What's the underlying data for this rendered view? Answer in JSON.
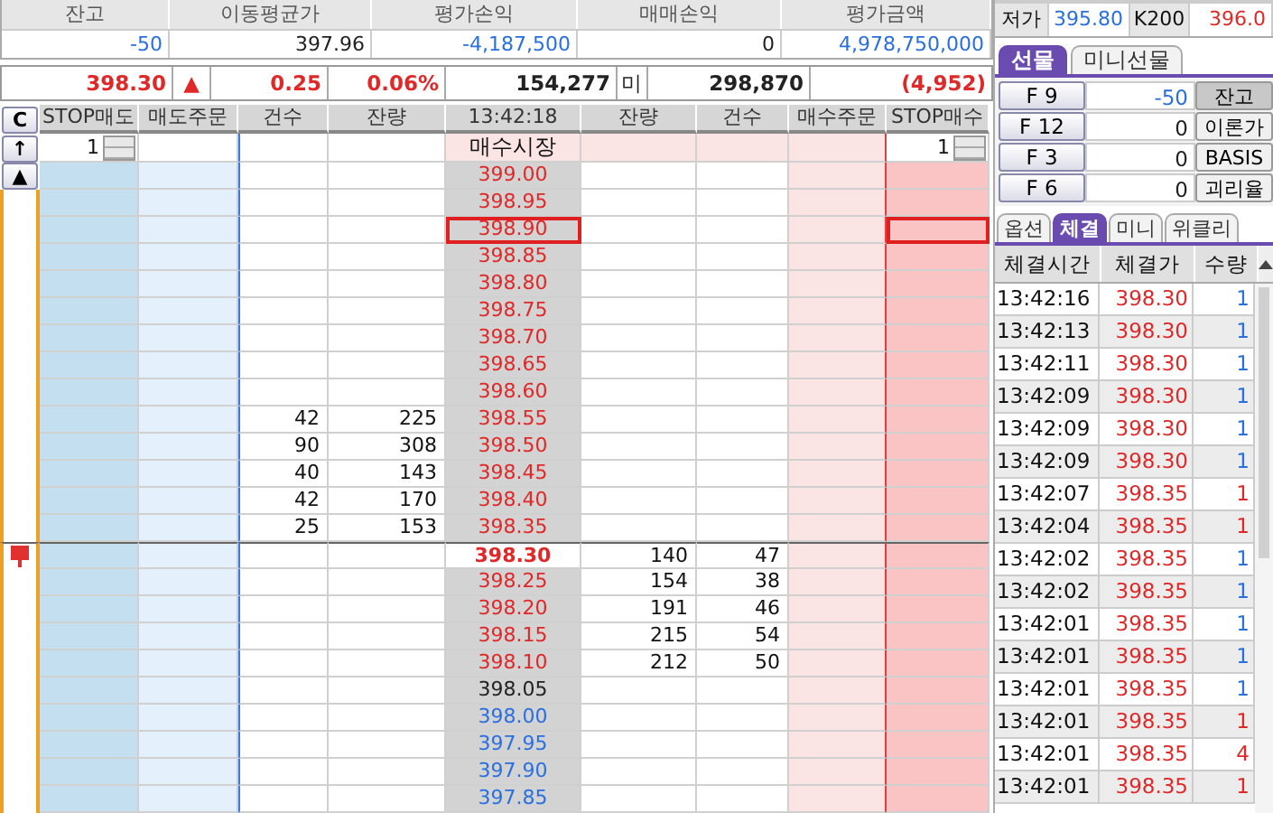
{
  "summary": {
    "columns": [
      "잔고",
      "이동평균가",
      "평가손익",
      "매매손익",
      "평가금액"
    ],
    "values": [
      {
        "text": "-50",
        "color": "#2a6fe0"
      },
      {
        "text": "397.96",
        "color": "#222222"
      },
      {
        "text": "-4,187,500",
        "color": "#2a6fe0"
      },
      {
        "text": "0",
        "color": "#222222"
      },
      {
        "text": "4,978,750,000",
        "color": "#2a6fe0"
      }
    ]
  },
  "quote": [
    {
      "text": "398.30",
      "color": "#e02828"
    },
    {
      "text": "▲",
      "color": "#e02828"
    },
    {
      "text": "0.25",
      "color": "#e02828"
    },
    {
      "text": "0.06%",
      "color": "#e02828"
    },
    {
      "text": "154,277",
      "color": "#222222"
    },
    {
      "text": "미",
      "color": "#222222"
    },
    {
      "text": "298,870",
      "color": "#222222"
    },
    {
      "text": "(4,952)",
      "color": "#e02828"
    }
  ],
  "side_buttons": [
    "C",
    "↑",
    "▲"
  ],
  "order_grid": {
    "columns": [
      "STOP매도",
      "매도주문",
      "건수",
      "잔량",
      "13:42:18",
      "잔량",
      "건수",
      "매수주문",
      "STOP매수"
    ],
    "stop_sell_qty": "1",
    "market_buy": "매수시장",
    "stop_buy_qty": "1",
    "rows": [
      {
        "price": "399.00",
        "color": "#e02828",
        "current": false,
        "outlined": false
      },
      {
        "price": "398.95",
        "color": "#e02828",
        "current": false,
        "outlined": false
      },
      {
        "price": "398.90",
        "color": "#e02828",
        "current": false,
        "outlined": true
      },
      {
        "price": "398.85",
        "color": "#e02828",
        "current": false,
        "outlined": false
      },
      {
        "price": "398.80",
        "color": "#e02828",
        "current": false,
        "outlined": false
      },
      {
        "price": "398.75",
        "color": "#e02828",
        "current": false,
        "outlined": false
      },
      {
        "price": "398.70",
        "color": "#e02828",
        "current": false,
        "outlined": false
      },
      {
        "price": "398.65",
        "color": "#e02828",
        "current": false,
        "outlined": false
      },
      {
        "price": "398.60",
        "color": "#e02828",
        "current": false,
        "outlined": false
      },
      {
        "price": "398.55",
        "color": "#e02828",
        "current": false,
        "outlined": false,
        "sell_count": "42",
        "sell_qty": "225"
      },
      {
        "price": "398.50",
        "color": "#e02828",
        "current": false,
        "outlined": false,
        "sell_count": "90",
        "sell_qty": "308"
      },
      {
        "price": "398.45",
        "color": "#e02828",
        "current": false,
        "outlined": false,
        "sell_count": "40",
        "sell_qty": "143"
      },
      {
        "price": "398.40",
        "color": "#e02828",
        "current": false,
        "outlined": false,
        "sell_count": "42",
        "sell_qty": "170"
      },
      {
        "price": "398.35",
        "color": "#e02828",
        "current": false,
        "outlined": false,
        "sell_count": "25",
        "sell_qty": "153"
      },
      {
        "price": "398.30",
        "color": "#e02828",
        "current": true,
        "outlined": false,
        "buy_qty": "140",
        "buy_count": "47"
      },
      {
        "price": "398.25",
        "color": "#e02828",
        "current": false,
        "outlined": false,
        "buy_qty": "154",
        "buy_count": "38"
      },
      {
        "price": "398.20",
        "color": "#e02828",
        "current": false,
        "outlined": false,
        "buy_qty": "191",
        "buy_count": "46"
      },
      {
        "price": "398.15",
        "color": "#e02828",
        "current": false,
        "outlined": false,
        "buy_qty": "215",
        "buy_count": "54"
      },
      {
        "price": "398.10",
        "color": "#e02828",
        "current": false,
        "outlined": false,
        "buy_qty": "212",
        "buy_count": "50"
      },
      {
        "price": "398.05",
        "color": "#222222",
        "current": false,
        "outlined": false
      },
      {
        "price": "398.00",
        "color": "#2a6fe0",
        "current": false,
        "outlined": false
      },
      {
        "price": "397.95",
        "color": "#2a6fe0",
        "current": false,
        "outlined": false
      },
      {
        "price": "397.90",
        "color": "#2a6fe0",
        "current": false,
        "outlined": false
      },
      {
        "price": "397.85",
        "color": "#2a6fe0",
        "current": false,
        "outlined": false
      }
    ]
  },
  "price_info": [
    {
      "label": "저가",
      "value": "395.80",
      "color": "#2a6fe0"
    },
    {
      "label": "K200",
      "value": "396.0",
      "color": "#e02828"
    }
  ],
  "futures_tabs": [
    {
      "label": "선물",
      "selected": true
    },
    {
      "label": "미니선물",
      "selected": false
    }
  ],
  "positions": [
    {
      "code": "F 9",
      "value": "-50",
      "color": "#2a6fe0",
      "action": "잔고",
      "pressed": true
    },
    {
      "code": "F 12",
      "value": "0",
      "color": "#222222",
      "action": "이론가",
      "pressed": false
    },
    {
      "code": "F 3",
      "value": "0",
      "color": "#222222",
      "action": "BASIS",
      "pressed": false
    },
    {
      "code": "F 6",
      "value": "0",
      "color": "#222222",
      "action": "괴리율",
      "pressed": false
    }
  ],
  "trade_tabs": [
    {
      "label": "옵션",
      "selected": false
    },
    {
      "label": "체결",
      "selected": true
    },
    {
      "label": "미니",
      "selected": false
    },
    {
      "label": "위클리",
      "selected": false
    }
  ],
  "trades": {
    "columns": [
      "체결시간",
      "체결가",
      "수량"
    ],
    "rows": [
      {
        "time": "13:42:16",
        "price": "398.30",
        "qty": "1",
        "color": "#2a6fe0"
      },
      {
        "time": "13:42:13",
        "price": "398.30",
        "qty": "1",
        "color": "#2a6fe0"
      },
      {
        "time": "13:42:11",
        "price": "398.30",
        "qty": "1",
        "color": "#2a6fe0"
      },
      {
        "time": "13:42:09",
        "price": "398.30",
        "qty": "1",
        "color": "#2a6fe0"
      },
      {
        "time": "13:42:09",
        "price": "398.30",
        "qty": "1",
        "color": "#2a6fe0"
      },
      {
        "time": "13:42:09",
        "price": "398.30",
        "qty": "1",
        "color": "#2a6fe0"
      },
      {
        "time": "13:42:07",
        "price": "398.35",
        "qty": "1",
        "color": "#e02828"
      },
      {
        "time": "13:42:04",
        "price": "398.35",
        "qty": "1",
        "color": "#e02828"
      },
      {
        "time": "13:42:02",
        "price": "398.35",
        "qty": "1",
        "color": "#2a6fe0"
      },
      {
        "time": "13:42:02",
        "price": "398.35",
        "qty": "1",
        "color": "#2a6fe0"
      },
      {
        "time": "13:42:01",
        "price": "398.35",
        "qty": "1",
        "color": "#2a6fe0"
      },
      {
        "time": "13:42:01",
        "price": "398.35",
        "qty": "1",
        "color": "#2a6fe0"
      },
      {
        "time": "13:42:01",
        "price": "398.35",
        "qty": "1",
        "color": "#2a6fe0"
      },
      {
        "time": "13:42:01",
        "price": "398.35",
        "qty": "1",
        "color": "#e02828"
      },
      {
        "time": "13:42:01",
        "price": "398.35",
        "qty": "4",
        "color": "#e02828"
      },
      {
        "time": "13:42:01",
        "price": "398.35",
        "qty": "1",
        "color": "#e02828"
      }
    ]
  }
}
